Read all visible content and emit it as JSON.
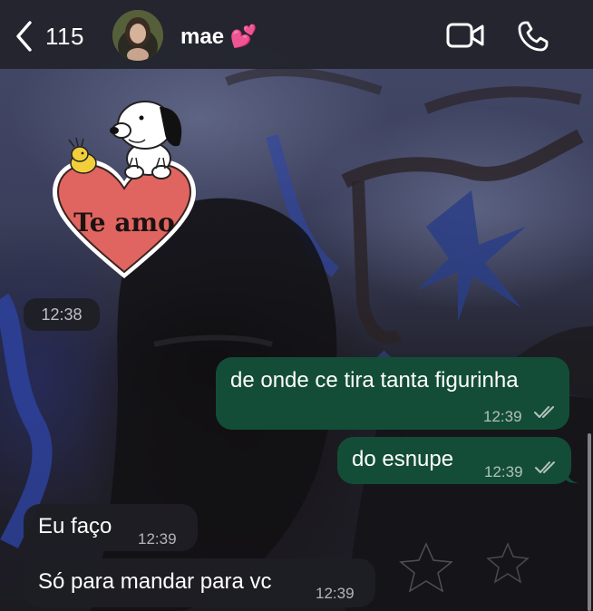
{
  "header": {
    "back_count": "115",
    "contact_name": "mae 💕"
  },
  "sticker": {
    "text": "Te amo"
  },
  "messages": [
    {
      "direction": "in",
      "type": "sticker",
      "time": "12:38"
    },
    {
      "direction": "out",
      "text": "de onde ce tira tanta figurinha",
      "time": "12:39",
      "status": "read"
    },
    {
      "direction": "out",
      "text": "do esnupe",
      "time": "12:39",
      "status": "read"
    },
    {
      "direction": "in",
      "text": "Eu faço",
      "time": "12:39"
    },
    {
      "direction": "in",
      "text": "Só para mandar para vc",
      "time": "12:39"
    }
  ],
  "colors": {
    "header_bg": "#22232c",
    "outgoing_bubble": "#144d37",
    "incoming_bubble": "#1e1f24",
    "heart": "#e06560"
  },
  "icons": {
    "back": "chevron-left-icon",
    "video": "video-camera-icon",
    "call": "phone-icon",
    "read_receipt": "double-check-icon"
  }
}
